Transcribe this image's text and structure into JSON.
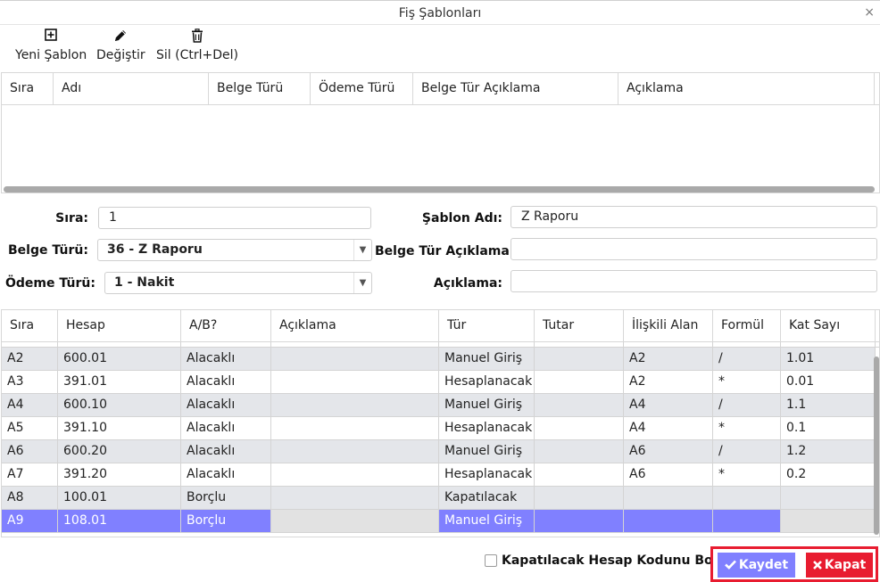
{
  "window": {
    "title": "Fiş Şablonları",
    "close_glyph": "×"
  },
  "toolbar": {
    "new_label": "Yeni Şablon",
    "new_icon": "plus-square-icon",
    "edit_label": "Değiştir",
    "edit_icon": "pencil-icon",
    "delete_label": "Sil (Ctrl+Del)",
    "delete_icon": "trash-icon"
  },
  "templates_grid": {
    "columns": [
      "Sıra",
      "Adı",
      "Belge Türü",
      "Ödeme Türü",
      "Belge Tür Açıklama",
      "Açıklama"
    ],
    "rows": []
  },
  "form": {
    "sira_label": "Sıra:",
    "sira_value": "1",
    "belge_turu_label": "Belge Türü:",
    "belge_turu_value": "36 - Z Raporu",
    "odeme_turu_label": "Ödeme Türü:",
    "odeme_turu_value": "1 - Nakit",
    "sablon_adi_label": "Şablon Adı:",
    "sablon_adi_value": "Z Raporu",
    "belge_tur_aciklama_label": "Belge Tür Açıklama:",
    "belge_tur_aciklama_value": "",
    "aciklama_label": "Açıklama:",
    "aciklama_value": ""
  },
  "lines_grid": {
    "columns": [
      "Sıra",
      "Hesap",
      "A/B?",
      "Açıklama",
      "Tür",
      "Tutar",
      "İlişkili Alan",
      "Formül",
      "Kat Sayı"
    ],
    "rows": [
      {
        "sira": "A2",
        "hesap": "600.01",
        "ab": "Alacaklı",
        "aciklama": "",
        "tur": "Manuel Giriş",
        "tutar": "",
        "iliskili": "A2",
        "formul": "/",
        "katsayi": "1.01"
      },
      {
        "sira": "A3",
        "hesap": "391.01",
        "ab": "Alacaklı",
        "aciklama": "",
        "tur": "Hesaplanacak",
        "tutar": "",
        "iliskili": "A2",
        "formul": "*",
        "katsayi": "0.01"
      },
      {
        "sira": "A4",
        "hesap": "600.10",
        "ab": "Alacaklı",
        "aciklama": "",
        "tur": "Manuel Giriş",
        "tutar": "",
        "iliskili": "A4",
        "formul": "/",
        "katsayi": "1.1"
      },
      {
        "sira": "A5",
        "hesap": "391.10",
        "ab": "Alacaklı",
        "aciklama": "",
        "tur": "Hesaplanacak",
        "tutar": "",
        "iliskili": "A4",
        "formul": "*",
        "katsayi": "0.1"
      },
      {
        "sira": "A6",
        "hesap": "600.20",
        "ab": "Alacaklı",
        "aciklama": "",
        "tur": "Manuel Giriş",
        "tutar": "",
        "iliskili": "A6",
        "formul": "/",
        "katsayi": "1.2"
      },
      {
        "sira": "A7",
        "hesap": "391.20",
        "ab": "Alacaklı",
        "aciklama": "",
        "tur": "Hesaplanacak",
        "tutar": "",
        "iliskili": "A6",
        "formul": "*",
        "katsayi": "0.2"
      },
      {
        "sira": "A8",
        "hesap": "100.01",
        "ab": "Borçlu",
        "aciklama": "",
        "tur": "Kapatılacak",
        "tutar": "",
        "iliskili": "",
        "formul": "",
        "katsayi": ""
      },
      {
        "sira": "A9",
        "hesap": "108.01",
        "ab": "Borçlu",
        "aciklama": "",
        "tur": "Manuel Giriş",
        "tutar": "",
        "iliskili": "",
        "formul": "",
        "katsayi": ""
      }
    ],
    "selected_row": "A9"
  },
  "footer": {
    "checkbox_label": "Kapatılacak Hesap Kodunu Boşalt",
    "checkbox_checked": false,
    "save_label": "Kaydet",
    "save_icon": "check-icon",
    "close_label": "Kapat",
    "close_icon": "x-icon"
  },
  "colors": {
    "accent": "#8080ff",
    "danger": "#e81c30",
    "alt_row": "#e4e6ea",
    "scrollbar": "#a9a9a9"
  }
}
